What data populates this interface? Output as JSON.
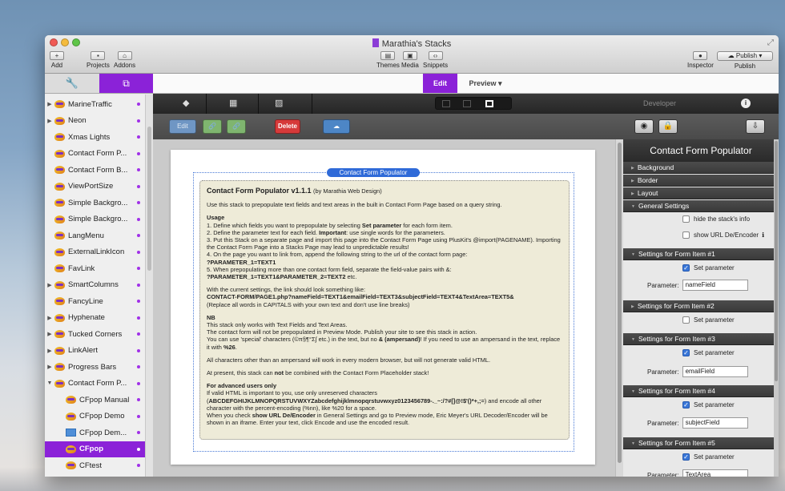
{
  "window": {
    "title": "Marathia's Stacks"
  },
  "toolbar": {
    "add": "Add",
    "projects": "Projects",
    "addons": "Addons",
    "themes": "Themes",
    "media": "Media",
    "snippets": "Snippets",
    "inspector": "Inspector",
    "publish": "Publish",
    "publish_btn": "Publish"
  },
  "left_tabs": {
    "first": "🔧",
    "second": "⧉"
  },
  "sidebar": {
    "items": [
      {
        "label": "MarineTraffic",
        "tri": "▶"
      },
      {
        "label": "Neon",
        "tri": "▶"
      },
      {
        "label": "Xmas Lights",
        "tri": ""
      },
      {
        "label": "Contact Form P...",
        "tri": ""
      },
      {
        "label": "Contact Form B...",
        "tri": ""
      },
      {
        "label": "ViewPortSize",
        "tri": ""
      },
      {
        "label": "Simple Backgro...",
        "tri": ""
      },
      {
        "label": "Simple Backgro...",
        "tri": ""
      },
      {
        "label": "LangMenu",
        "tri": ""
      },
      {
        "label": "ExternalLinkIcon",
        "tri": ""
      },
      {
        "label": "FavLink",
        "tri": ""
      },
      {
        "label": "SmartColumns",
        "tri": "▶"
      },
      {
        "label": "FancyLine",
        "tri": ""
      },
      {
        "label": "Hyphenate",
        "tri": "▶"
      },
      {
        "label": "Tucked Corners",
        "tri": "▶"
      },
      {
        "label": "LinkAlert",
        "tri": "▶"
      },
      {
        "label": "Progress Bars",
        "tri": "▶"
      },
      {
        "label": "Contact Form P...",
        "tri": "▼"
      },
      {
        "label": "CFpop Manual",
        "tri": ""
      },
      {
        "label": "CFpop Demo",
        "tri": ""
      },
      {
        "label": "CFpop Dem...",
        "tri": ""
      },
      {
        "label": "CFpop",
        "tri": ""
      },
      {
        "label": "CFtest",
        "tri": ""
      }
    ]
  },
  "editbar": {
    "edit": "Edit",
    "preview": "Preview ▾"
  },
  "greybar": {
    "edit": "Edit",
    "link1": "🔗",
    "link2": "🔗",
    "delete": "Delete",
    "cloud": "☁"
  },
  "stack": {
    "tag": "Contact Form Populator",
    "heading": "Contact Form Populator v1.1.1",
    "by": "(by Marathia Web Design)",
    "intro": "Use this stack to prepopulate text fields and text areas in the built in Contact Form Page based on a query string.",
    "usage_title": "Usage",
    "usage": [
      "1. Define which fields you want to prepopulate by selecting ",
      "Set parameter",
      " for each form item.",
      "2. Define the parameter text for each field. ",
      "Important",
      ": use single words for the parameters.",
      "3. Put this Stack on a separate page and import this page into the Contact Form Page using PlusKit's @import(PAGENAME). Importing the Contact Form Page into a Stacks Page may lead to unpredictable results!",
      "4. On the page you want to link from, append the following string to the url of the contact form page:",
      "?PARAMETER_1=TEXT1",
      "5. When prepopulating more than one contact form field, separate the field-value pairs with &:",
      "?PARAMETER_1=TEXT1&PARAMETER_2=TEXT2",
      " etc."
    ],
    "current_intro": "With the current settings, the link should look something like:",
    "current_link": "CONTACT-FORM/PAGE1.php?nameField=TEXT1&emailField=TEXT3&subjectField=TEXT4&TextArea=TEXT5&",
    "current_note": "(Replace all words in CAPITALS with your own text and don't use line breaks)",
    "nb_title": "NB",
    "nb": [
      "This stack only works with Text Fields and Text Areas.",
      "The contact form will not be prepopulated in Preview Mode. Publish your site to see this stack in action.",
      "You can use 'special' characters (©π§¶°Σ∫ etc.) in the text, but no ",
      "& (ampersand)",
      "! If you need to use an ampersand in the text, replace it with ",
      "%26",
      "."
    ],
    "browsers": "All characters other than an ampersand will work in every modern browser, but will not generate valid HTML.",
    "combine_a": "At present, this stack can ",
    "combine_b": "not",
    "combine_c": " be combined with the Contact Form Placeholder stack!",
    "adv_title": "For advanced users only",
    "adv_a": "If valid HTML is important to you, use only unreserved characters (",
    "adv_chars": "ABCDEFGHIJKLMNOPQRSTUVWXYZabcdefghijklmnopqrstuvwxyz0123456789-._~:/?#[]@!$'()*+,;=",
    "adv_b": ") and encode all other character with the percent-encoding (%nn), like %20 for a space.",
    "adv_c": "When you check ",
    "adv_d": "show URL De/Encoder",
    "adv_e": " in General Settings and go to Preview mode, Eric Meyer's URL Decoder/Encoder will be shown in an iframe. Enter your text, click Encode and use the encoded result."
  },
  "right": {
    "developer": "Developer",
    "info": "i",
    "title": "Contact Form Populator",
    "sections": {
      "background": "Background",
      "border": "Border",
      "layout": "Layout",
      "general": "General Settings",
      "item1": "Settings for Form Item #1",
      "item2": "Settings for Form Item #2",
      "item3": "Settings for Form Item #3",
      "item4": "Settings for Form Item #4",
      "item5": "Settings for Form Item #5"
    },
    "hide_info": "hide the stack's info",
    "show_url": "show URL De/Encoder",
    "show_url_info": "ℹ",
    "set_param": "Set parameter",
    "param_label": "Parameter:",
    "params": [
      "nameField",
      "emailField",
      "subjectField",
      "TextArea"
    ]
  }
}
